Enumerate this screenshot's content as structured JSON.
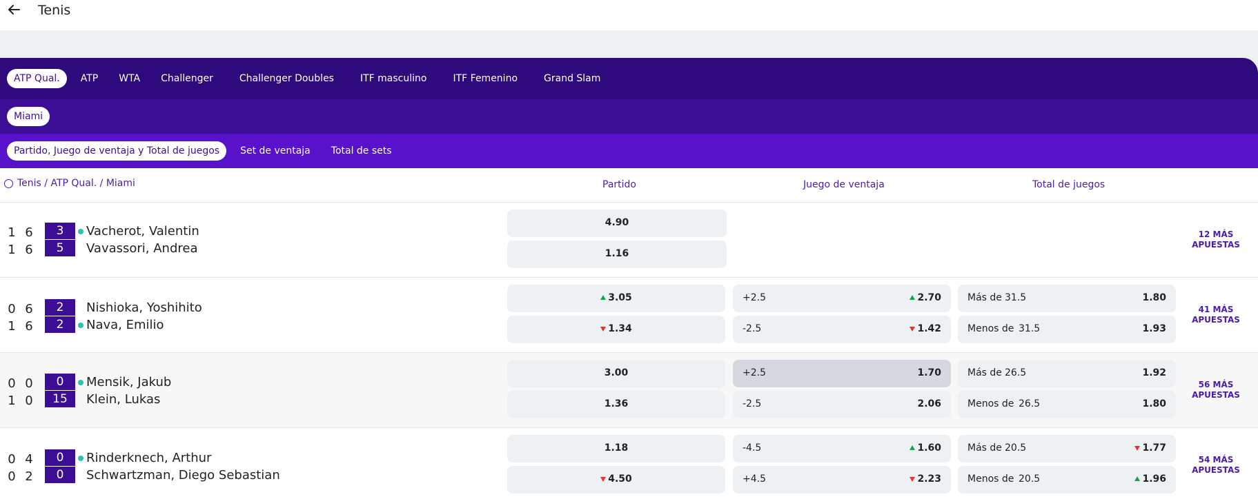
{
  "header": {
    "title": "Tenis"
  },
  "tabs_level1": [
    {
      "label": "ATP Qual.",
      "active": true
    },
    {
      "label": "ATP"
    },
    {
      "label": "WTA"
    },
    {
      "label": "Challenger"
    },
    {
      "label": "Challenger Doubles"
    },
    {
      "label": "ITF masculino"
    },
    {
      "label": "ITF Femenino"
    },
    {
      "label": "Grand Slam"
    }
  ],
  "tabs_level2": [
    {
      "label": "Miami",
      "active": true
    }
  ],
  "tabs_level3": [
    {
      "label": "Partido, Juego de ventaja y Total de juegos",
      "active": true
    },
    {
      "label": "Set de ventaja"
    },
    {
      "label": "Total de sets"
    }
  ],
  "breadcrumb": "Tenis / ATP Qual. / Miami",
  "columns": {
    "match": "Partido",
    "handicap": "Juego de ventaja",
    "total": "Total de juegos"
  },
  "matches": [
    {
      "p1": {
        "name": "Vacherot, Valentin",
        "s1": "1",
        "s2": "6",
        "game": "3",
        "serving": true
      },
      "p2": {
        "name": "Vavassori, Andrea",
        "s1": "1",
        "s2": "6",
        "game": "5",
        "serving": false
      },
      "odds": {
        "o1": "4.90",
        "o2": "1.16"
      },
      "more": "12 MÁS APUESTAS"
    },
    {
      "p1": {
        "name": "Nishioka, Yoshihito",
        "s1": "0",
        "s2": "6",
        "game": "2",
        "serving": false
      },
      "p2": {
        "name": "Nava, Emilio",
        "s1": "1",
        "s2": "6",
        "game": "2",
        "serving": true
      },
      "odds": {
        "o1": "3.05",
        "o2": "1.34"
      },
      "handicap": {
        "h1": "+2.5",
        "h1o": "2.70",
        "h2": "-2.5",
        "h2o": "1.42"
      },
      "total": {
        "t1l": "Más de",
        "t1v": "31.5",
        "t1o": "1.80",
        "t2l": "Menos de",
        "t2v": "31.5",
        "t2o": "1.93"
      },
      "more": "41 MÁS APUESTAS"
    },
    {
      "p1": {
        "name": "Mensik, Jakub",
        "s1": "0",
        "s2": "0",
        "game": "0",
        "serving": true
      },
      "p2": {
        "name": "Klein, Lukas",
        "s1": "1",
        "s2": "0",
        "game": "15",
        "serving": false
      },
      "odds": {
        "o1": "3.00",
        "o2": "1.36"
      },
      "handicap": {
        "h1": "+2.5",
        "h1o": "1.70",
        "h2": "-2.5",
        "h2o": "2.06"
      },
      "total": {
        "t1l": "Más de",
        "t1v": "26.5",
        "t1o": "1.92",
        "t2l": "Menos de",
        "t2v": "26.5",
        "t2o": "1.80"
      },
      "more": "56 MÁS APUESTAS"
    },
    {
      "p1": {
        "name": "Rinderknech, Arthur",
        "s1": "0",
        "s2": "4",
        "game": "0",
        "serving": true
      },
      "p2": {
        "name": "Schwartzman, Diego Sebastian",
        "s1": "0",
        "s2": "2",
        "game": "0",
        "serving": false
      },
      "odds": {
        "o1": "1.18",
        "o2": "4.50"
      },
      "handicap": {
        "h1": "-4.5",
        "h1o": "1.60",
        "h2": "+4.5",
        "h2o": "2.23"
      },
      "total": {
        "t1l": "Más de",
        "t1v": "20.5",
        "t1o": "1.77",
        "t2l": "Menos de",
        "t2v": "20.5",
        "t2o": "1.96"
      },
      "more": "54 MÁS APUESTAS"
    }
  ],
  "colors": {
    "nav1": "#2e0a7d",
    "nav2": "#3b0e95",
    "nav3": "#5812c9",
    "accent": "#4a1ca8",
    "up": "#18a34a",
    "down": "#e03434",
    "serve_dot": "#2fbfb4"
  }
}
